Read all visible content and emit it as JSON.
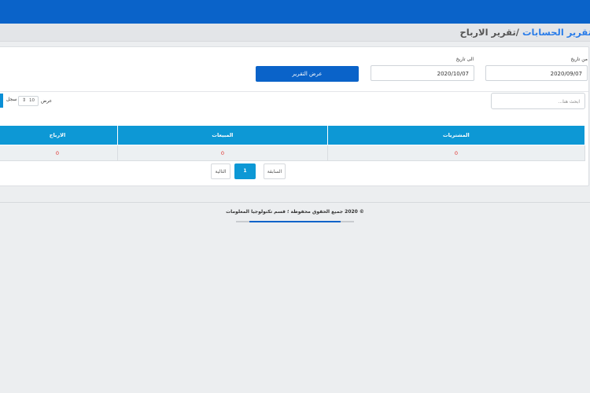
{
  "breadcrumb": {
    "parent": "تقرير الحسابات",
    "separator": " /",
    "current": "تقرير الارباح"
  },
  "filters": {
    "from_label": "من تاريخ",
    "from_value": "2020/09/07",
    "to_label": "الى تاريخ",
    "to_value": "2020/10/07",
    "show_report_label": "عرض التقرير"
  },
  "table_controls": {
    "search_placeholder": "ابحث هنا...",
    "show_prefix": "عرض",
    "page_length": "10",
    "show_suffix": "سجل"
  },
  "table": {
    "headers": [
      "المشتريات",
      "المبيعات",
      "الارباح"
    ],
    "rows": [
      [
        "0",
        "0",
        "0"
      ]
    ]
  },
  "pagination": {
    "prev_label": "السابقة",
    "current_page": "1",
    "next_label": "التالية"
  },
  "footer": {
    "text": "© 2020 جميع الحقوق محفوظة ؛ قسم تكنولوجيا المعلومات"
  },
  "colors": {
    "brand": "#0a63c9",
    "table_header": "#0d98d5",
    "value_red": "#e0302c"
  }
}
